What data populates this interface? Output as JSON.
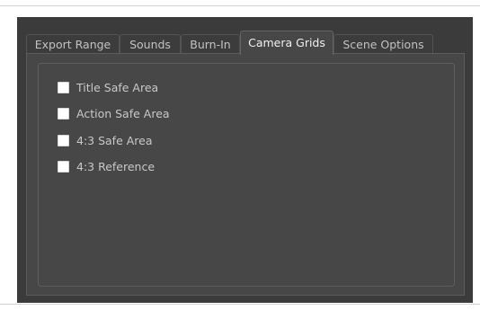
{
  "tabs": [
    {
      "label": "Export Range",
      "active": false
    },
    {
      "label": "Sounds",
      "active": false
    },
    {
      "label": "Burn-In",
      "active": false
    },
    {
      "label": "Camera Grids",
      "active": true
    },
    {
      "label": "Scene Options",
      "active": false
    }
  ],
  "camera_grids": {
    "options": [
      {
        "label": "Title Safe Area",
        "checked": false
      },
      {
        "label": "Action Safe Area",
        "checked": false
      },
      {
        "label": "4:3 Safe Area",
        "checked": false
      },
      {
        "label": "4:3 Reference",
        "checked": false
      }
    ]
  }
}
